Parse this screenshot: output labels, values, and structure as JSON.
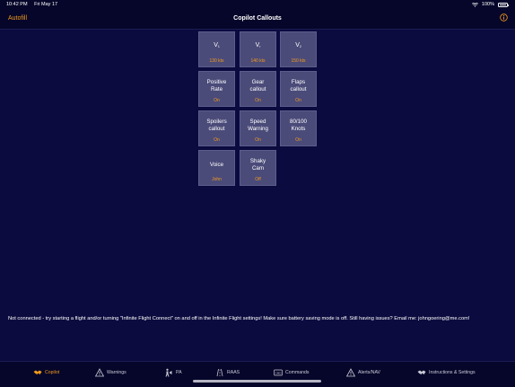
{
  "status": {
    "time": "10:42 PM",
    "date": "Fri May 17",
    "battery": "100%"
  },
  "nav": {
    "left_label": "Autofill",
    "title": "Copilot Callouts",
    "info_icon": "info-circle-icon"
  },
  "tiles": [
    {
      "label": "V",
      "sub": "1",
      "value": "130 kts"
    },
    {
      "label": "V",
      "sub": "r",
      "value": "140 kts"
    },
    {
      "label": "V",
      "sub": "2",
      "value": "150 kts"
    },
    {
      "label": "Positive Rate",
      "value": "On"
    },
    {
      "label": "Gear callout",
      "value": "On"
    },
    {
      "label": "Flaps callout",
      "value": "On"
    },
    {
      "label": "Spoilers callout",
      "value": "On"
    },
    {
      "label": "Speed Warning",
      "value": "On"
    },
    {
      "label": "80/100 Knots",
      "value": "On"
    },
    {
      "label": "Voice",
      "value": "John"
    },
    {
      "label": "Shaky Cam",
      "value": "Off"
    }
  ],
  "message": "Not connected - try starting a flight and/or turning \"Infinite Flight Connect\" on and off in the Infinite Flight settings! Make sure battery saving mode is off. Still having issues? Email me: johngoering@me.com!",
  "tabs": [
    {
      "label": "Copilot",
      "icon": "copilot-handshake-icon",
      "active": true
    },
    {
      "label": "Warnings",
      "icon": "warning-triangle-icon"
    },
    {
      "label": "PA",
      "icon": "pa-person-icon"
    },
    {
      "label": "RAAS",
      "icon": "runway-icon"
    },
    {
      "label": "Commands",
      "icon": "cmd-icon"
    },
    {
      "label": "Alerts/NAV",
      "icon": "alert-triangle-icon"
    },
    {
      "label": "Instructions & Settings",
      "icon": "settings-handshake-icon"
    }
  ],
  "colors": {
    "background": "#0b0b3f",
    "accent": "#f39a1a",
    "tile": "#4b4b7a"
  }
}
